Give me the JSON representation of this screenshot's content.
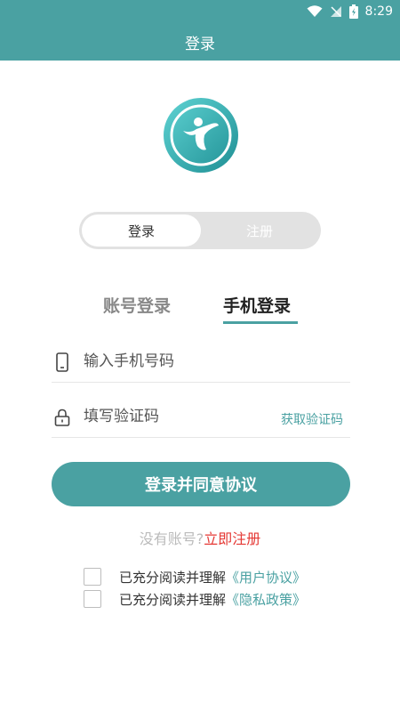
{
  "status_bar": {
    "time": "8:29"
  },
  "header": {
    "title": "登录"
  },
  "mode_toggle": {
    "login": "登录",
    "register": "注册"
  },
  "login_tabs": {
    "account": "账号登录",
    "phone": "手机登录"
  },
  "phone_field": {
    "placeholder": "输入手机号码"
  },
  "code_field": {
    "placeholder": "填写验证码",
    "get_code": "获取验证码"
  },
  "login_button": {
    "label": "登录并同意协议"
  },
  "register_hint": {
    "question": "没有账号?",
    "link": "立即注册"
  },
  "agreements": [
    {
      "prefix": "已充分阅读并理解",
      "doc": "《用户协议》"
    },
    {
      "prefix": "已充分阅读并理解",
      "doc": "《隐私政策》"
    }
  ],
  "colors": {
    "accent": "#4aa1a2",
    "link_red": "#e53935"
  }
}
